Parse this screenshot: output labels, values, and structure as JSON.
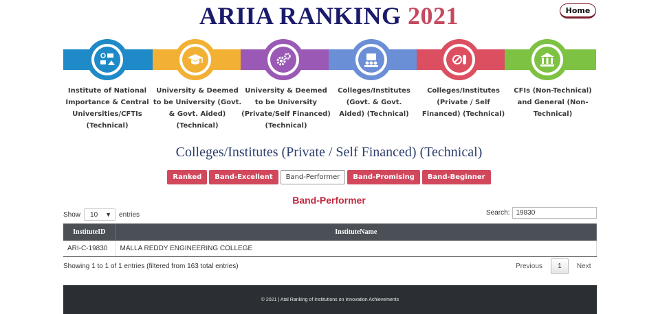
{
  "header": {
    "title_main": "ARIIA RANKING",
    "title_year": "2021",
    "home_label": "Home"
  },
  "categories": [
    {
      "label": "Institute of National Importance & Central Universities/CFTIs (Technical)",
      "icon": "campus-icon",
      "color": "#1e8ac7"
    },
    {
      "label": "University & Deemed to be University (Govt. & Govt. Aided) (Technical)",
      "icon": "graduation-cap-icon",
      "color": "#f2b134"
    },
    {
      "label": "University & Deemed to be University (Private/Self Financed) (Technical)",
      "icon": "gears-icon",
      "color": "#9b59b6"
    },
    {
      "label": "Colleges/Institutes (Govt. & Govt. Aided) (Technical)",
      "icon": "meeting-icon",
      "color": "#6b8fd6"
    },
    {
      "label": "Colleges/Institutes (Private / Self Financed) (Technical)",
      "icon": "pill-icon",
      "color": "#dc4f61"
    },
    {
      "label": "CFIs (Non-Technical) and General (Non-Technical)",
      "icon": "building-icon",
      "color": "#7dc242"
    }
  ],
  "section_title": "Colleges/Institutes (Private / Self Financed) (Technical)",
  "filters": [
    {
      "label": "Ranked"
    },
    {
      "label": "Band-Excellent"
    },
    {
      "label": "Band-Performer"
    },
    {
      "label": "Band-Promising"
    },
    {
      "label": "Band-Beginner"
    }
  ],
  "active_filter": "Band-Performer",
  "band_title": "Band-Performer",
  "table_controls": {
    "show_label": "Show",
    "show_value": "10",
    "entries_label": "entries",
    "search_label": "Search:",
    "search_value": "19830"
  },
  "table": {
    "columns": [
      "InstituteID",
      "InstituteName"
    ],
    "rows": [
      [
        "ARI-C-19830",
        "MALLA REDDY ENGINEERING COLLEGE"
      ]
    ]
  },
  "info_text": "Showing 1 to 1 of 1 entries (filtered from 163 total entries)",
  "pagination": {
    "previous": "Previous",
    "current": "1",
    "next": "Next"
  },
  "footer_text": "© 2021 | Atal Ranking of Institutions on Innovation Achievements"
}
